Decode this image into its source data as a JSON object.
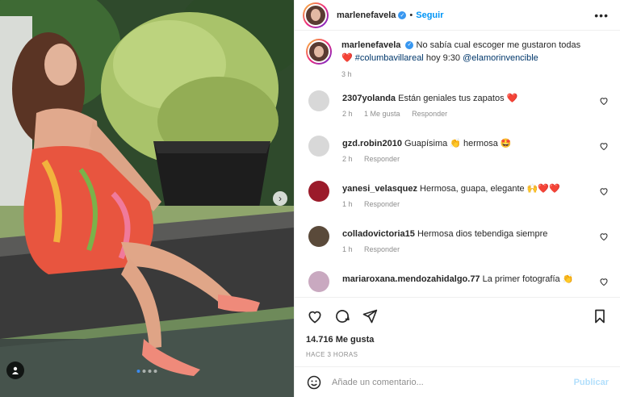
{
  "post": {
    "username": "marlenefavela",
    "follow_label": "Seguir",
    "separator": "•",
    "more_icon": "more-horizontal-icon"
  },
  "caption": {
    "username": "marlenefavela",
    "text": "No sabía cual escoger me gustaron todas",
    "heart": "❤️",
    "hashtag": "#columbavillareal",
    "text2": "hoy 9:30",
    "mention": "@elamorinvencible",
    "age": "3 h"
  },
  "comments": [
    {
      "user": "2307yolanda",
      "text": "Están geniales tus zapatos ❤️",
      "age": "2 h",
      "likes": "1 Me gusta",
      "reply": "Responder",
      "avatar_color": "#d8d8d8"
    },
    {
      "user": "gzd.robin2010",
      "text": "Guapísima 👏 hermosa 🤩",
      "age": "2 h",
      "likes": "",
      "reply": "Responder",
      "avatar_color": "#d8d8d8"
    },
    {
      "user": "yanesi_velasquez",
      "text": "Hermosa, guapa, elegante 🙌❤️❤️",
      "age": "1 h",
      "likes": "",
      "reply": "Responder",
      "avatar_color": "#9b1b2a"
    },
    {
      "user": "colladovictoria15",
      "text": "Hermosa dios tebendiga siempre",
      "age": "1 h",
      "likes": "",
      "reply": "Responder",
      "avatar_color": "#5a4a3a"
    },
    {
      "user": "mariaroxana.mendozahidalgo.77",
      "text": "La primer fotografía 👏",
      "age": "",
      "likes": "",
      "reply": "",
      "avatar_color": "#c9a9c0"
    }
  ],
  "actions": {
    "likes": "14.716 Me gusta",
    "time": "HACE 3 HORAS"
  },
  "add_comment": {
    "placeholder": "Añade un comentario...",
    "publish": "Publicar"
  },
  "carousel": {
    "slides": 4,
    "active": 1
  },
  "colors": {
    "accent": "#0095f6",
    "heart": "#ed4956",
    "muted": "#8e8e8e"
  }
}
